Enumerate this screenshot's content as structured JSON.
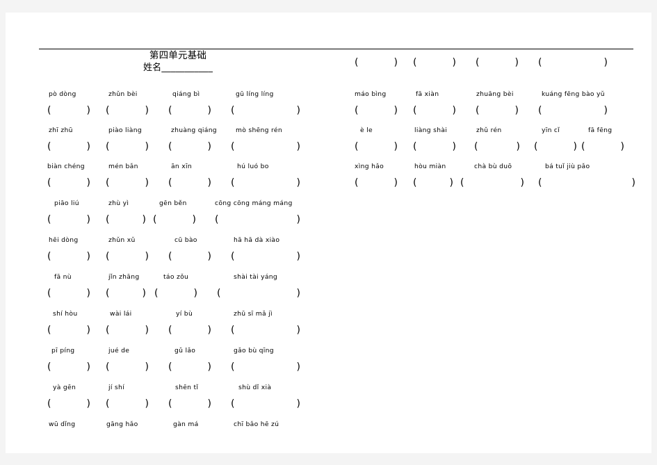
{
  "document": {
    "title": "第四单元基础",
    "name_label": "姓名___________"
  },
  "left_column": {
    "rows": [
      {
        "words": [
          "pò dòng",
          "zhǔn bèi",
          "qiáng bì",
          "gū líng líng"
        ]
      },
      {
        "words": [
          "zhī zhū",
          "piào liàng",
          "zhuàng qiáng",
          "mò shēng rén"
        ]
      },
      {
        "words": [
          "biàn chéng",
          "mén bǎn",
          "ān xīn",
          "hú luó bo"
        ]
      },
      {
        "words": [
          "piāo liú",
          "zhù yì",
          "gēn běn",
          "cōng cōng máng máng"
        ]
      },
      {
        "words": [
          "hēi dòng",
          "zhǔn xǔ",
          "cū bào",
          "hā hā dà xiào"
        ]
      },
      {
        "words": [
          "fā nù",
          "jǐn zhāng",
          "táo zǒu",
          "shài tài yáng"
        ]
      },
      {
        "words": [
          "shí hòu",
          "wài lái",
          "yí bù",
          "zhū sī mǎ jì"
        ]
      },
      {
        "words": [
          "pī píng",
          "jué de",
          "gǔ lǎo",
          "gǎo bù qīng"
        ]
      },
      {
        "words": [
          "yà gēn",
          "jí shí",
          "shēn tǐ",
          "shù dǐ xià"
        ]
      },
      {
        "words": [
          "wū dǐng",
          "gāng hǎo",
          "gàn má",
          "chī bǎo hē zú"
        ]
      }
    ]
  },
  "right_column": {
    "rows": [
      {
        "words": [
          "máo bìng",
          "fā xiàn",
          "zhuāng bèi",
          "kuáng fēng bào yǔ"
        ]
      },
      {
        "words": [
          "è le",
          "liàng shài",
          "zhǔ rén",
          "yīn cǐ",
          "fā fēng"
        ]
      },
      {
        "words": [
          "xìng hǎo",
          "hòu miàn",
          "chà bù duō",
          "bá tuǐ jiù pǎo"
        ]
      }
    ]
  },
  "answer_box": {
    "open": "(",
    "close": ")"
  }
}
